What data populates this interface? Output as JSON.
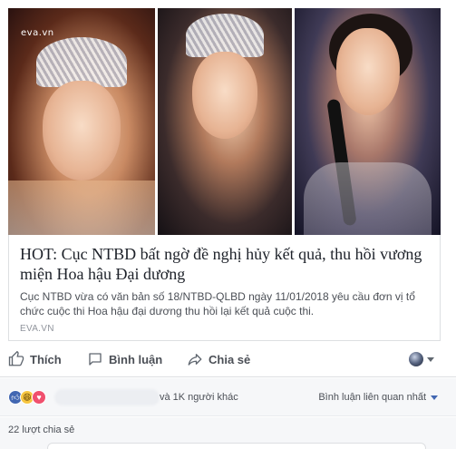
{
  "media": {
    "logo_text": "eva.vn",
    "photo_count": 3
  },
  "link_card": {
    "title": "HOT: Cục NTBD bất ngờ đề nghị hủy kết quả, thu hồi vương miện Hoa hậu Đại dương",
    "description": "Cục NTBD vừa có văn bản số 18/NTBD-QLBD ngày 11/01/2018 yêu cầu đơn vị tổ chức cuộc thi Hoa hậu đại dương thu hồi lại kết quả cuộc thi.",
    "domain": "EVA.VN"
  },
  "actions": {
    "like_label": "Thích",
    "comment_label": "Bình luận",
    "share_label": "Chia sẻ"
  },
  "reactions": {
    "types": [
      "like-icon",
      "haha-icon",
      "love-icon"
    ],
    "summary_text": "và 1K người khác",
    "sort_label": "Bình luận liên quan nhất"
  },
  "shares": {
    "count_text": "22 lượt chia sẻ"
  },
  "colors": {
    "accent": "#4267b2",
    "text_secondary": "#4b4f56",
    "border": "#dddfe2",
    "love": "#f0506e",
    "haha": "#f7c641"
  }
}
